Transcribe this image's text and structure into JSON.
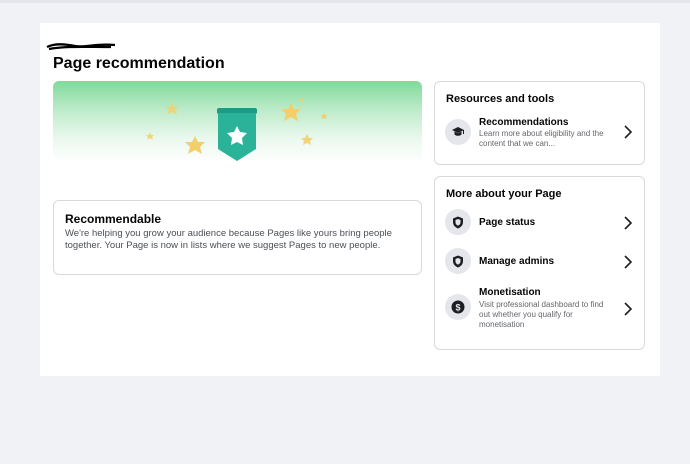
{
  "page": {
    "title": "Page recommendation"
  },
  "recommendable": {
    "title": "Recommendable",
    "description": "We're helping you grow your audience because Pages like yours bring people together. Your Page is now in lists where we suggest Pages to new people."
  },
  "resources": {
    "title": "Resources and tools",
    "items": [
      {
        "label": "Recommendations",
        "description": "Learn more about eligibility and the content that we can...",
        "icon": "graduation-cap-icon"
      }
    ]
  },
  "more": {
    "title": "More about your Page",
    "items": [
      {
        "label": "Page status",
        "icon": "shield-icon"
      },
      {
        "label": "Manage admins",
        "icon": "shield-icon"
      },
      {
        "label": "Monetisation",
        "description": "Visit professional dashboard to find out whether you qualify for monetisation",
        "icon": "dollar-icon"
      }
    ]
  },
  "colors": {
    "badge": "#2bb39a",
    "star": "#f2cf6b",
    "background": "#f0f2f5"
  }
}
